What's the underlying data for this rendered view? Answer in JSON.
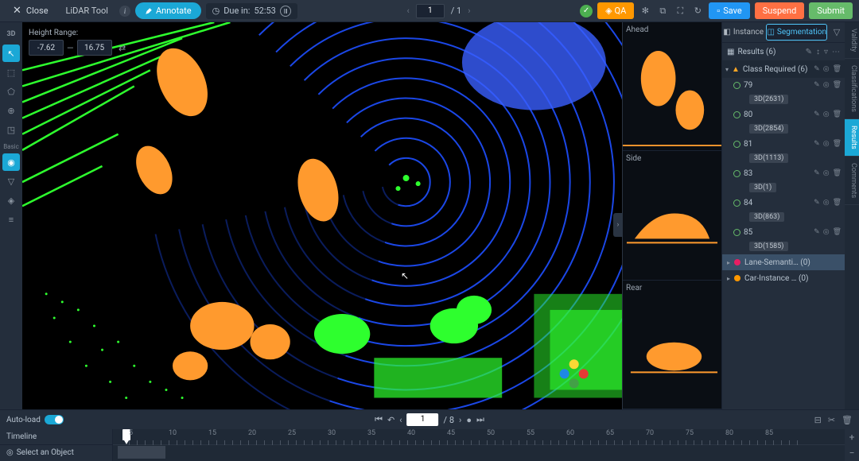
{
  "topbar": {
    "close": "Close",
    "tool_name": "LiDAR Tool",
    "annotate": "Annotate",
    "due_label": "Due in:",
    "due_time": "52:53",
    "page_current": "1",
    "page_total": "/ 1",
    "qa": "QA",
    "save": "Save",
    "suspend": "Suspend",
    "submit": "Submit"
  },
  "tool_rail": {
    "label_3d": "3D",
    "section_basic": "Basic"
  },
  "height_range": {
    "label": "Height Range:",
    "min": "-7.62",
    "max": "16.75"
  },
  "side_views": {
    "ahead": "Ahead",
    "side": "Side",
    "rear": "Rear"
  },
  "right_panel": {
    "tab_instance": "Instance",
    "tab_segmentation": "Segmentation",
    "results_label": "Results (6)",
    "class_required": "Class Required  (6)",
    "objects": [
      {
        "id": "79",
        "tag": "3D(2631)"
      },
      {
        "id": "80",
        "tag": "3D(2854)"
      },
      {
        "id": "81",
        "tag": "3D(1113)"
      },
      {
        "id": "83",
        "tag": "3D(1)"
      },
      {
        "id": "84",
        "tag": "3D(863)"
      },
      {
        "id": "85",
        "tag": "3D(1585)"
      }
    ],
    "lane_semantic": "Lane-Semanti…  (0)",
    "car_instance": "Car-Instance …  (0)"
  },
  "vtabs": {
    "validity": "Validity",
    "classifications": "Classifications",
    "results": "Results",
    "comments": "Comments"
  },
  "bottom": {
    "autoload": "Auto-load",
    "frame_current": "1",
    "frame_total": "/ 8",
    "timeline": "Timeline",
    "select_object": "Select an Object",
    "ticks": [
      "5",
      "10",
      "15",
      "20",
      "25",
      "30",
      "35",
      "40",
      "45",
      "50",
      "55",
      "60",
      "65",
      "70",
      "75",
      "80",
      "85"
    ]
  }
}
